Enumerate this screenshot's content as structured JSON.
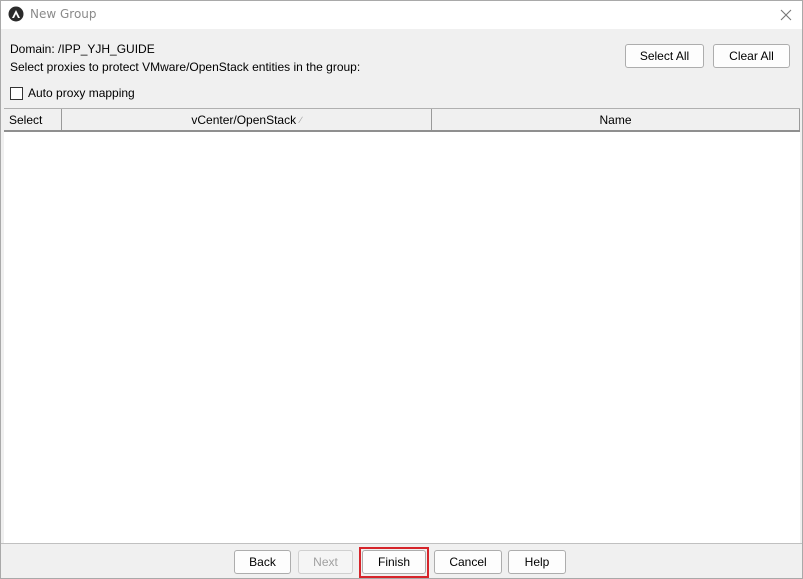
{
  "window": {
    "title": "New Group"
  },
  "header": {
    "domain_text": "Domain: /IPP_YJH_GUIDE",
    "instruction_text": "Select proxies to protect VMware/OpenStack entities in the group:"
  },
  "actions": {
    "select_all_label": "Select All",
    "clear_all_label": "Clear All"
  },
  "auto_proxy": {
    "label": "Auto proxy mapping",
    "checked": false
  },
  "table": {
    "columns": [
      "Select",
      "vCenter/OpenStack",
      "Name"
    ],
    "sort_indicator": "∕",
    "rows": []
  },
  "footer": {
    "back_label": "Back",
    "next_label": "Next",
    "finish_label": "Finish",
    "cancel_label": "Cancel",
    "help_label": "Help"
  },
  "colors": {
    "highlight": "#d6252b",
    "disabled_text": "#a0a0a0"
  },
  "icons": {
    "app": "app-logo-icon",
    "close": "close-icon",
    "sort": "sort-ascending-icon"
  }
}
